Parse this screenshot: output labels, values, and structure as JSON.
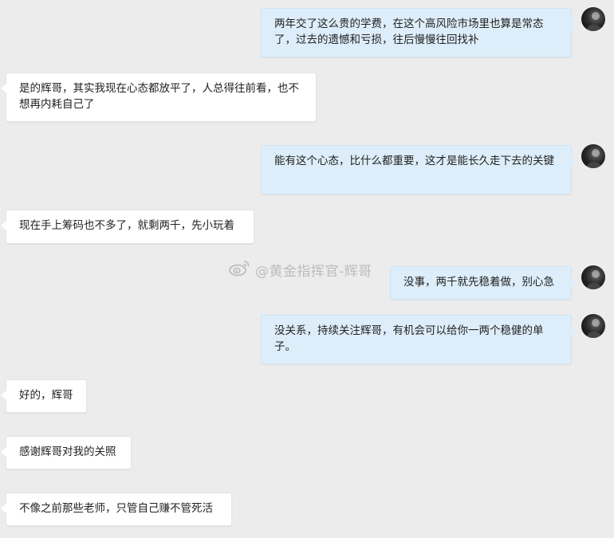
{
  "watermark": {
    "text": "@黄金指挥官-辉哥"
  },
  "messages": [
    {
      "side": "out",
      "text": "两年交了这么贵的学费，在这个高风险市场里也算是常态了，过去的遗憾和亏损，往后慢慢往回找补"
    },
    {
      "side": "in",
      "text": "是的辉哥，其实我现在心态都放平了，人总得往前看，也不想再内耗自己了"
    },
    {
      "side": "out",
      "text": "能有这个心态，比什么都重要，这才是能长久走下去的关键"
    },
    {
      "side": "in",
      "text": "现在手上筹码也不多了，就剩两千，先小玩着"
    },
    {
      "side": "out",
      "text": "没事，两千就先稳着做，别心急"
    },
    {
      "side": "out",
      "text": "没关系，持续关注辉哥，有机会可以给你一两个稳健的单子。"
    },
    {
      "side": "in",
      "text": "好的，辉哥"
    },
    {
      "side": "in",
      "text": "感谢辉哥对我的关照"
    },
    {
      "side": "in",
      "text": "不像之前那些老师，只管自己赚不管死活"
    }
  ]
}
